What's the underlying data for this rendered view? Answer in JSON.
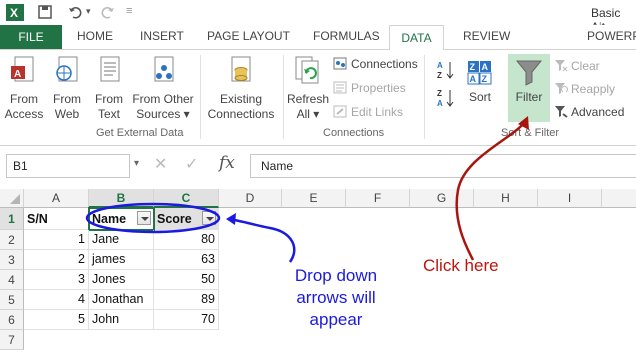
{
  "window": {
    "title": "Basic Ait"
  },
  "tabs": [
    "FILE",
    "HOME",
    "INSERT",
    "PAGE LAYOUT",
    "FORMULAS",
    "DATA",
    "REVIEW",
    "POWERP"
  ],
  "active_tab": "DATA",
  "ribbon": {
    "get_external": {
      "from_access": "From\nAccess",
      "from_web": "From\nWeb",
      "from_text": "From\nText",
      "from_other": "From Other\nSources ▾",
      "existing": "Existing\nConnections",
      "group_label": "Get External Data"
    },
    "connections": {
      "refresh": "Refresh\nAll ▾",
      "connections": "Connections",
      "properties": "Properties",
      "edit_links": "Edit Links",
      "group_label": "Connections"
    },
    "sort_filter": {
      "sort": "Sort",
      "filter": "Filter",
      "clear": "Clear",
      "reapply": "Reapply",
      "advanced": "Advanced",
      "group_label": "Sort & Filter"
    }
  },
  "formula_bar": {
    "name_box": "B1",
    "content": "Name",
    "fx": "fx"
  },
  "columns": [
    "A",
    "B",
    "C",
    "D",
    "E",
    "F",
    "G",
    "H",
    "I"
  ],
  "rows": [
    "1",
    "2",
    "3",
    "4",
    "5",
    "6",
    "7"
  ],
  "sheet": {
    "a1": "S/N",
    "b1": "Name",
    "c1": "Score",
    "data": [
      {
        "sn": "1",
        "name": "Jane",
        "score": "80"
      },
      {
        "sn": "2",
        "name": "james",
        "score": "63"
      },
      {
        "sn": "3",
        "name": "Jones",
        "score": "50"
      },
      {
        "sn": "4",
        "name": "Jonathan",
        "score": "89"
      },
      {
        "sn": "5",
        "name": "John",
        "score": "70"
      }
    ]
  },
  "annotations": {
    "blue": "Drop down\narrows will\nappear",
    "red": "Click here"
  },
  "colors": {
    "accent": "#217346",
    "annotation_blue": "#1a1ae0",
    "annotation_red": "#c0140c"
  }
}
